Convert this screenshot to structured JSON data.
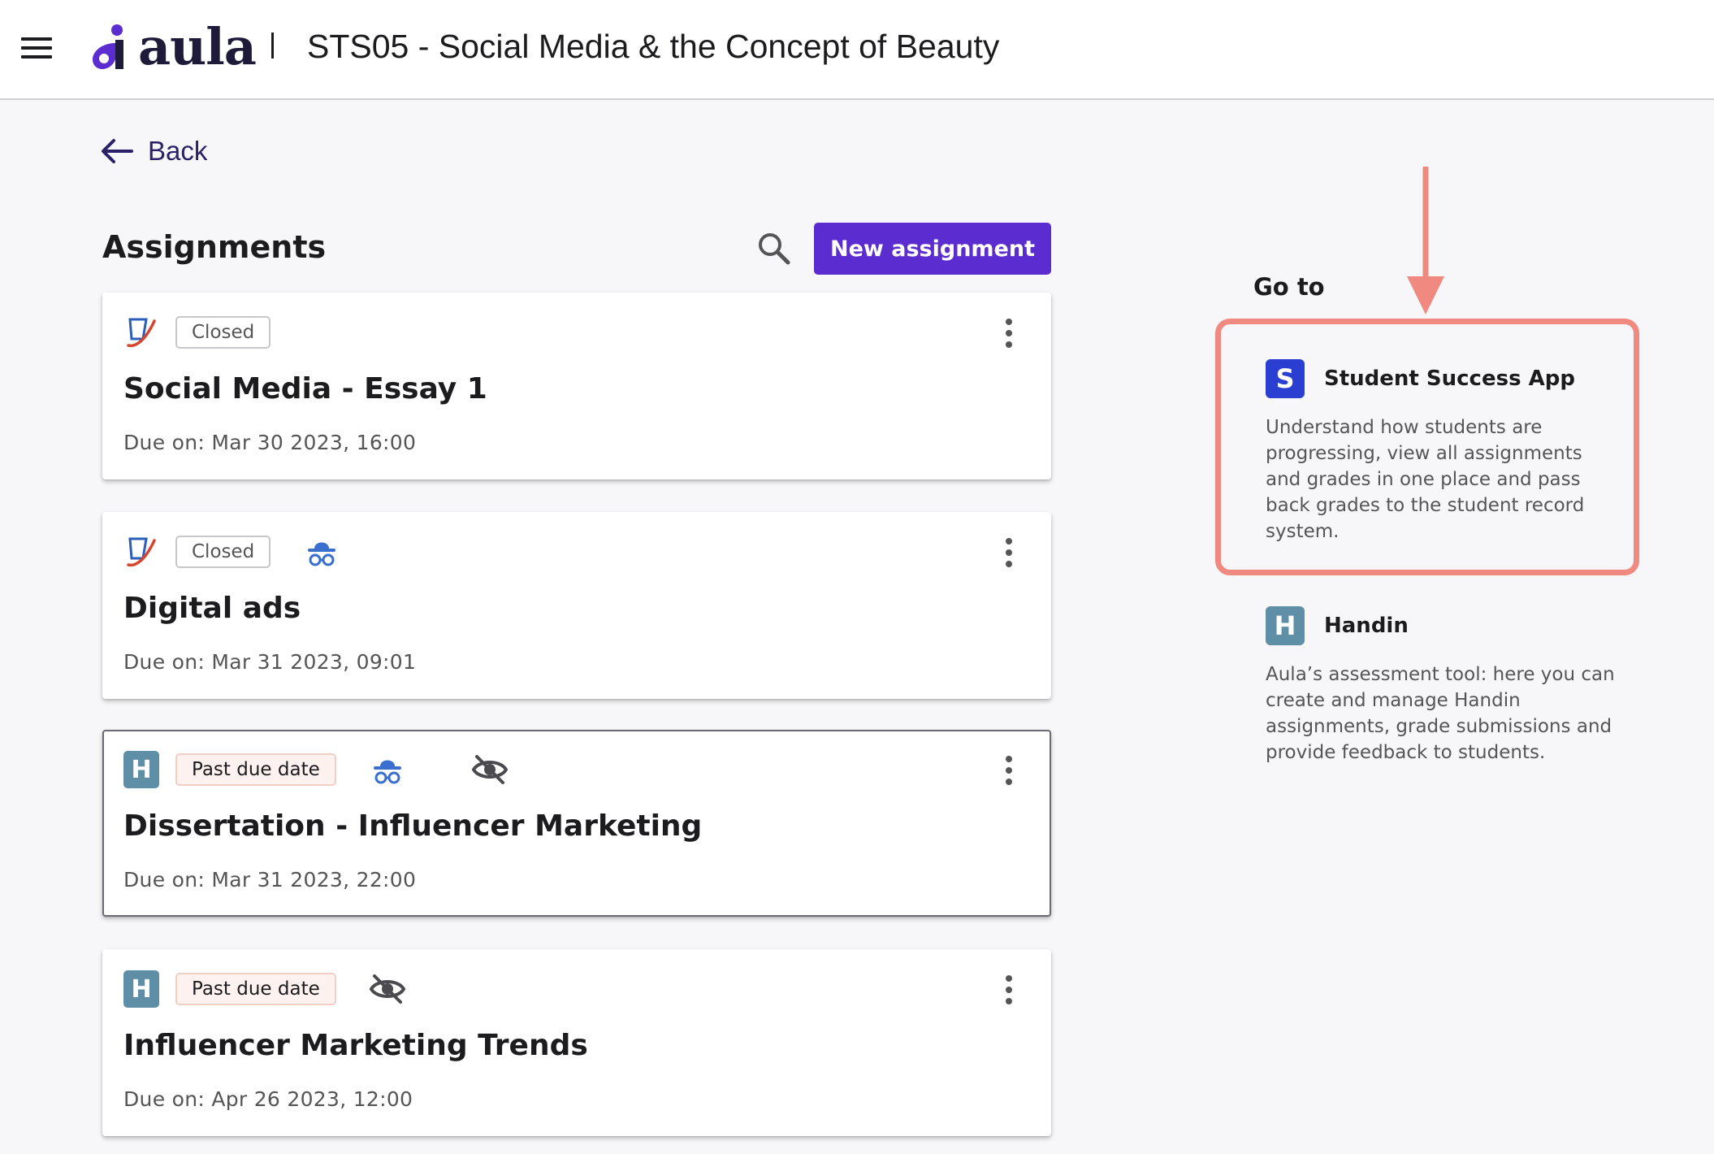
{
  "header": {
    "logo_text": "aula",
    "course_title": "STS05 - Social Media & the Concept of Beauty"
  },
  "nav": {
    "back_label": "Back"
  },
  "assignments": {
    "title": "Assignments",
    "new_button_label": "New assignment",
    "items": [
      {
        "type_icon": "turnitin-icon",
        "status": "Closed",
        "extra_icons": [],
        "title": "Social Media - Essay 1",
        "due": "Due on: Mar 30 2023, 16:00"
      },
      {
        "type_icon": "turnitin-icon",
        "status": "Closed",
        "extra_icons": [
          "anonymous-icon"
        ],
        "title": "Digital ads",
        "due": "Due on: Mar 31 2023, 09:01"
      },
      {
        "type_icon": "handin-icon",
        "type_letter": "H",
        "status": "Past due date",
        "extra_icons": [
          "anonymous-icon",
          "hidden-icon"
        ],
        "title": "Dissertation - Influencer Marketing",
        "due": "Due on: Mar 31 2023, 22:00"
      },
      {
        "type_icon": "handin-icon",
        "type_letter": "H",
        "status": "Past due date",
        "extra_icons": [
          "hidden-icon"
        ],
        "title": "Influencer Marketing Trends",
        "due": "Due on: Apr 26 2023, 12:00"
      }
    ]
  },
  "goto": {
    "label": "Go to",
    "apps": [
      {
        "letter": "S",
        "name": "Student Success App",
        "description": "Understand how students are progressing, view all assignments and grades in one place and pass back grades to the student record system."
      },
      {
        "letter": "H",
        "name": "Handin",
        "description": "Aula’s assessment tool: here you can create and manage Handin assignments, grade submissions and provide feedback to students."
      }
    ]
  },
  "colors": {
    "brand": "#5b2ccf",
    "annotation": "#f08a80",
    "handin": "#5f8fa6",
    "student_success": "#2a3fd1"
  }
}
